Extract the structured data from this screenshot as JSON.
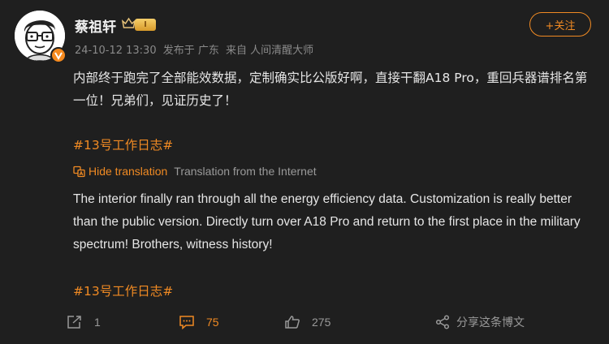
{
  "user": {
    "name": "蔡祖轩",
    "level": "I"
  },
  "meta": {
    "time": "24-10-12 13:30",
    "location": "发布于 广东",
    "source": "来自 人间清醒大师"
  },
  "follow_label": "+关注",
  "post": {
    "text": "内部终于跑完了全部能效数据，定制确实比公版好啊，直接干翻A18 Pro，重回兵器谱排名第一位！兄弟们，见证历史了！",
    "topic": "#13号工作日志#"
  },
  "translation": {
    "hide_label": "Hide translation",
    "source_label": "Translation from the Internet",
    "text": "The interior finally ran through all the energy efficiency data. Customization is really better than the public version. Directly turn over A18 Pro and return to the first place in the military spectrum! Brothers, witness history!",
    "topic": "#13号工作日志#"
  },
  "actions": {
    "forward_count": "1",
    "comment_count": "75",
    "like_count": "275",
    "share_label": "分享这条博文"
  },
  "colors": {
    "accent": "#f08a23",
    "background": "#1f1f1f",
    "text": "#e6e6e6",
    "muted": "#8a8a8a"
  },
  "icons": [
    "crown-icon",
    "verified-v-icon",
    "translate-icon",
    "forward-icon",
    "comment-icon",
    "like-icon",
    "share-icon"
  ]
}
